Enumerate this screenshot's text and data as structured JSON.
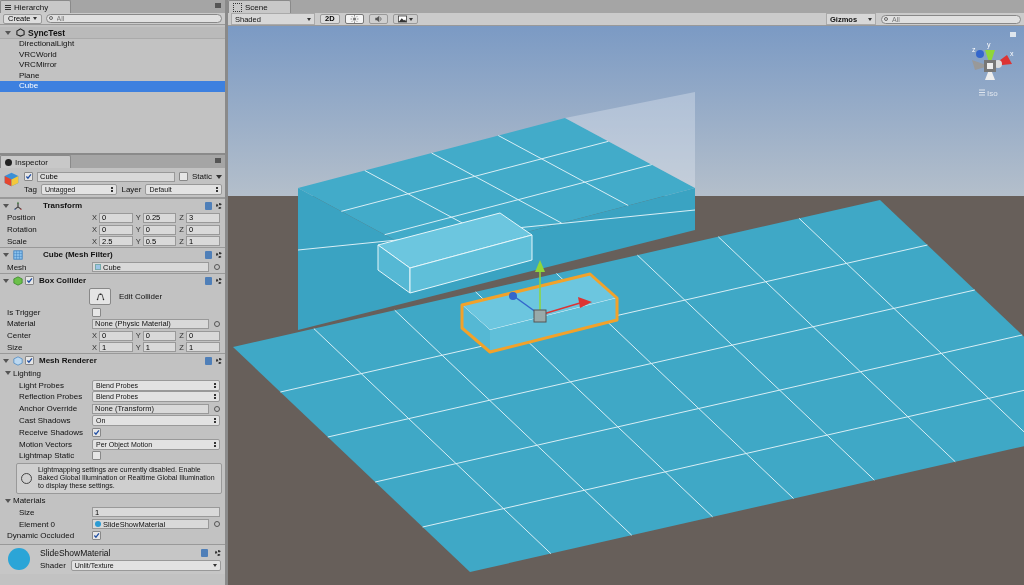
{
  "hierarchy": {
    "title": "Hierarchy",
    "create": "Create",
    "search_placeholder": "All",
    "scene": "SyncTest",
    "items": [
      {
        "label": "DirectionalLight",
        "selected": false
      },
      {
        "label": "VRCWorld",
        "selected": false
      },
      {
        "label": "VRCMirror",
        "selected": false
      },
      {
        "label": "Plane",
        "selected": false
      },
      {
        "label": "Cube",
        "selected": true
      }
    ]
  },
  "inspector": {
    "title": "Inspector",
    "object": {
      "active": true,
      "name": "Cube",
      "static": false,
      "static_label": "Static",
      "tag_label": "Tag",
      "tag": "Untagged",
      "layer_label": "Layer",
      "layer": "Default"
    },
    "components": [
      {
        "kind": "transform",
        "title": "Transform",
        "rows": [
          {
            "kind": "vector",
            "label": "Position",
            "parts": [
              {
                "axis": "X",
                "value": "0"
              },
              {
                "axis": "Y",
                "value": "0.25"
              },
              {
                "axis": "Z",
                "value": "3"
              }
            ]
          },
          {
            "kind": "vector",
            "label": "Rotation",
            "parts": [
              {
                "axis": "X",
                "value": "0"
              },
              {
                "axis": "Y",
                "value": "0"
              },
              {
                "axis": "Z",
                "value": "0"
              }
            ]
          },
          {
            "kind": "vector",
            "label": "Scale",
            "parts": [
              {
                "axis": "X",
                "value": "2.5"
              },
              {
                "axis": "Y",
                "value": "0.5"
              },
              {
                "axis": "Z",
                "value": "1"
              }
            ]
          }
        ]
      },
      {
        "kind": "mesh_filter",
        "title": "Cube (Mesh Filter)",
        "rows": [
          {
            "kind": "mesh",
            "label": "Mesh",
            "value": "Cube"
          }
        ]
      },
      {
        "kind": "collider",
        "title": "Box Collider",
        "enabled": true,
        "rows": [
          {
            "kind": "button",
            "value": "Edit Collider"
          },
          {
            "kind": "checkbox",
            "label": "Is Trigger",
            "checked": false
          },
          {
            "kind": "object",
            "label": "Material",
            "value": "None (Physic Material)"
          },
          {
            "kind": "vector",
            "label": "Center",
            "parts": [
              {
                "axis": "X",
                "value": "0"
              },
              {
                "axis": "Y",
                "value": "0"
              },
              {
                "axis": "Z",
                "value": "0"
              }
            ]
          },
          {
            "kind": "vector",
            "label": "Size",
            "parts": [
              {
                "axis": "X",
                "value": "1"
              },
              {
                "axis": "Y",
                "value": "1"
              },
              {
                "axis": "Z",
                "value": "1"
              }
            ]
          }
        ]
      },
      {
        "kind": "renderer",
        "title": "Mesh Renderer",
        "enabled": true,
        "rows": [
          {
            "kind": "section",
            "label": "Lighting"
          },
          {
            "kind": "dropdown",
            "label": "Light Probes",
            "value": "Blend Probes",
            "indent": true
          },
          {
            "kind": "dropdown",
            "label": "Reflection Probes",
            "value": "Blend Probes",
            "indent": true
          },
          {
            "kind": "object",
            "label": "Anchor Override",
            "value": "None (Transform)",
            "indent": true
          },
          {
            "kind": "dropdown",
            "label": "Cast Shadows",
            "value": "On",
            "indent": true
          },
          {
            "kind": "checkbox",
            "label": "Receive Shadows",
            "checked": true,
            "indent": true
          },
          {
            "kind": "dropdown",
            "label": "Motion Vectors",
            "value": "Per Object Motion",
            "indent": true
          },
          {
            "kind": "checkbox",
            "label": "Lightmap Static",
            "checked": false,
            "indent": true
          },
          {
            "kind": "help",
            "value": "Lightmapping settings are currently disabled. Enable Baked Global Illumination or Realtime Global Illumination to display these settings."
          },
          {
            "kind": "section",
            "label": "Materials"
          },
          {
            "kind": "text",
            "label": "Size",
            "value": "1",
            "indent": true
          },
          {
            "kind": "material",
            "label": "Element 0",
            "value": "SlideShowMaterial",
            "indent": true
          },
          {
            "kind": "checkbox",
            "label": "Dynamic Occluded",
            "checked": true
          }
        ]
      }
    ],
    "material": {
      "name": "SlideShowMaterial",
      "shader_label": "Shader",
      "shader": "Unlit/Texture"
    }
  },
  "scene": {
    "title": "Scene",
    "shading": "Shaded",
    "mode_2d": "2D",
    "toggles": [
      {
        "kind": "lighting",
        "on": true
      },
      {
        "kind": "audio",
        "on": false
      },
      {
        "kind": "effects",
        "on": false
      }
    ],
    "gizmos": "Gizmos",
    "search_placeholder": "All",
    "axes": [
      "y",
      "z",
      "x"
    ],
    "view": "Iso"
  }
}
